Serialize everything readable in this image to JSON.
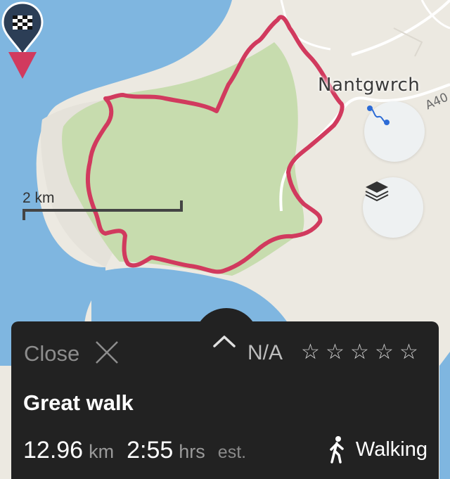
{
  "map": {
    "place_label": "Nantgwrch",
    "road_label": "A40",
    "scale_label": "2 km",
    "colors": {
      "water": "#7fb6e0",
      "land": "#ece9e1",
      "park": "#c7dcae",
      "route": "#d13a5e",
      "road": "#ffffff"
    }
  },
  "map_controls": {
    "route_button_icon": "route-icon",
    "layers_button_icon": "layers-icon"
  },
  "marker": {
    "icon": "checkered-flag-icon"
  },
  "sheet": {
    "close_label": "Close",
    "rating_label": "N/A",
    "stars": [
      "☆",
      "☆",
      "☆",
      "☆",
      "☆"
    ],
    "title": "Great walk",
    "distance_value": "12.96",
    "distance_unit": "km",
    "duration_value": "2:55",
    "duration_unit": "hrs",
    "estimate_label": "est.",
    "activity_label": "Walking"
  }
}
